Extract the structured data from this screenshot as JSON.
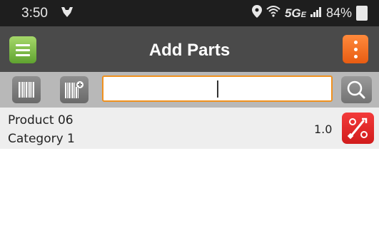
{
  "status_bar": {
    "time": "3:50",
    "network": "5G",
    "network_suffix": "E",
    "battery": "84%"
  },
  "header": {
    "title": "Add Parts"
  },
  "toolbar": {
    "search_value": "",
    "search_placeholder": ""
  },
  "parts": [
    {
      "name": "Product 06",
      "category": "Category 1",
      "quantity": "1.0"
    }
  ],
  "colors": {
    "header_bg": "#4a4a4a",
    "menu_green": "#5fa330",
    "more_orange": "#e85c12",
    "search_border": "#f0911e",
    "part_red": "#d11c1c"
  },
  "icons": {
    "menu": "hamburger-icon",
    "more": "kebab-icon",
    "scan": "barcode-icon",
    "scan_add": "barcode-add-icon",
    "search": "search-icon",
    "part": "tools-icon"
  }
}
